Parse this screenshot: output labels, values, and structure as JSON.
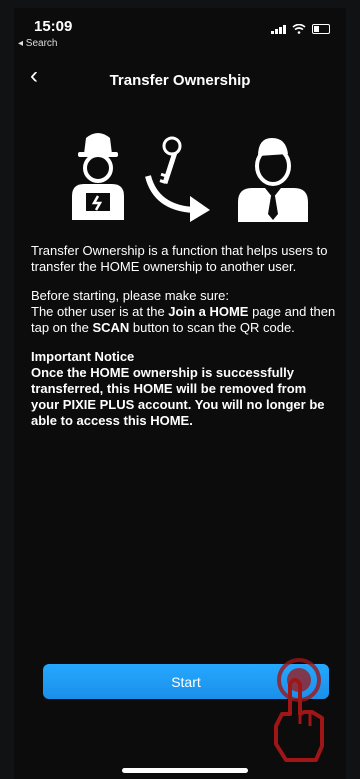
{
  "status_bar": {
    "time": "15:09",
    "back_label": "◂ Search"
  },
  "nav": {
    "back_icon": "‹",
    "title": "Transfer Ownership"
  },
  "content": {
    "paragraph_1": "Transfer Ownership is a function that helps users to transfer the HOME ownership to another user.",
    "paragraph_2_intro": "Before starting, please make sure:",
    "paragraph_2_text_a": "The other user is at the ",
    "paragraph_2_bold_a": "Join a HOME",
    "paragraph_2_text_b": " page and then tap on the ",
    "paragraph_2_bold_b": "SCAN",
    "paragraph_2_text_c": " button to scan the QR code.",
    "important_title": "Important Notice",
    "important_body": "Once the HOME ownership is successfully transferred, this HOME will be removed from your PIXIE PLUS account. You will no longer be able to access this HOME."
  },
  "button": {
    "start_label": "Start"
  },
  "icons": {
    "worker": "worker-icon",
    "key": "key-icon",
    "arrow": "curved-arrow-icon",
    "businessman": "businessman-icon",
    "hand": "hand-pointer-icon"
  },
  "colors": {
    "button_blue": "#1f9af3",
    "tap_red": "#b01818",
    "background": "#0c0c0d"
  }
}
